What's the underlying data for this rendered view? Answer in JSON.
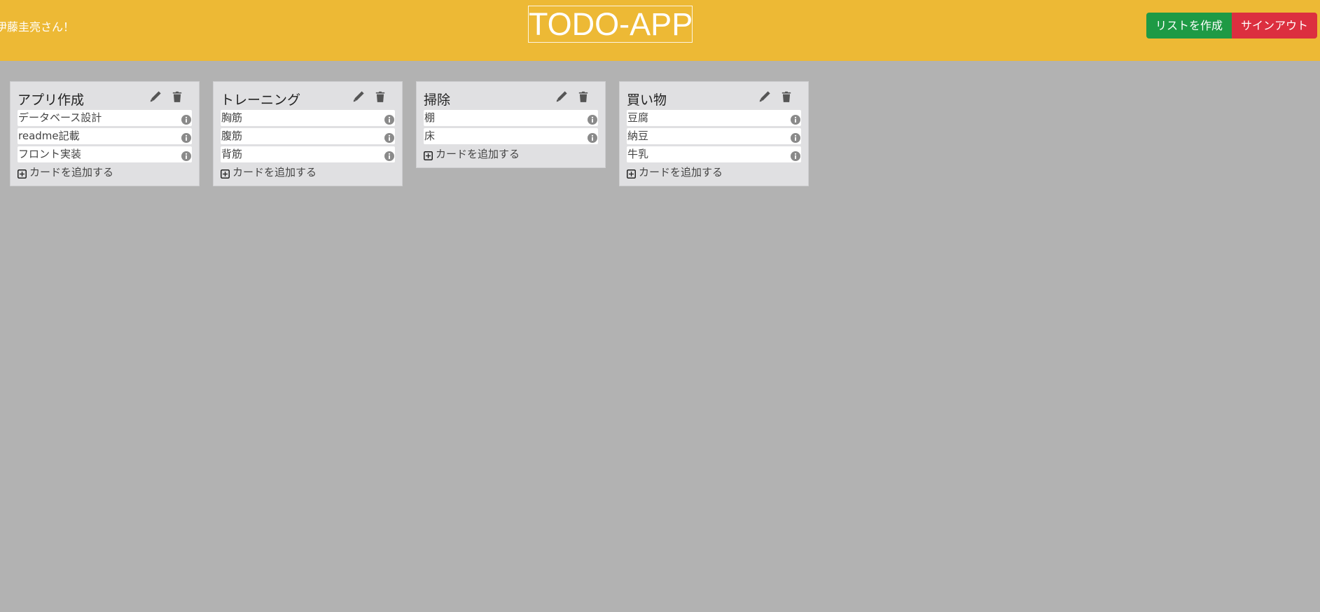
{
  "header": {
    "greeting": "伊藤圭亮さん！",
    "title": "TODO-APP",
    "create_list_label": "リストを作成",
    "sign_out_label": "サインアウト"
  },
  "lists": [
    {
      "title": "アプリ作成",
      "cards": [
        "データベース設計",
        "readme記載",
        "フロント実装"
      ],
      "add_card_label": "カードを追加する"
    },
    {
      "title": "トレーニング",
      "cards": [
        "胸筋",
        "腹筋",
        "背筋"
      ],
      "add_card_label": "カードを追加する"
    },
    {
      "title": "掃除",
      "cards": [
        "棚",
        "床"
      ],
      "add_card_label": "カードを追加する"
    },
    {
      "title": "買い物",
      "cards": [
        "豆腐",
        "納豆",
        "牛乳"
      ],
      "add_card_label": "カードを追加する"
    }
  ],
  "icons": {
    "edit": "pencil-icon",
    "delete": "trash-icon",
    "card_info": "info-icon",
    "add": "plus-square-icon"
  },
  "colors": {
    "header_bg": "#edb935",
    "board_bg": "#b2b2b2",
    "create_button": "#1e9a45",
    "sign_out_button": "#dc2f3f",
    "list_bg": "#e0e0e2"
  }
}
